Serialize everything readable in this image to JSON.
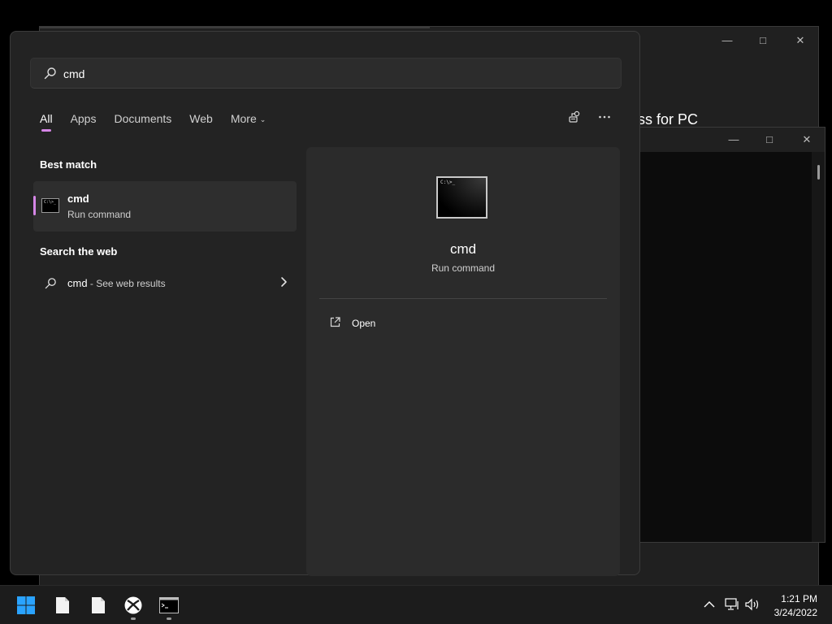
{
  "background_window": {
    "heading": "ss for PC"
  },
  "search": {
    "value": "cmd",
    "placeholder": ""
  },
  "tabs": [
    {
      "label": "All"
    },
    {
      "label": "Apps"
    },
    {
      "label": "Documents"
    },
    {
      "label": "Web"
    },
    {
      "label": "More"
    }
  ],
  "top_icons": [
    "share-feedback-icon",
    "more-icon"
  ],
  "best_match": {
    "section_label": "Best match",
    "name": "cmd",
    "subtitle": "Run command"
  },
  "web_search": {
    "section_label": "Search the web",
    "query": "cmd",
    "suffix": " - See web results"
  },
  "detail": {
    "name": "cmd",
    "subtitle": "Run command",
    "actions": [
      {
        "label": "Open",
        "icon": "open-external-icon"
      }
    ]
  },
  "thumb_text": "C:\\>_",
  "taskbar": {
    "apps": [
      "start-icon",
      "file-icon",
      "file-icon",
      "xbox-icon",
      "cmd-icon"
    ],
    "time": "1:21 PM",
    "date": "3/24/2022"
  },
  "colors": {
    "accent": "#d586e6",
    "start_blue": "#2aa3ff",
    "panel": "#232323"
  }
}
